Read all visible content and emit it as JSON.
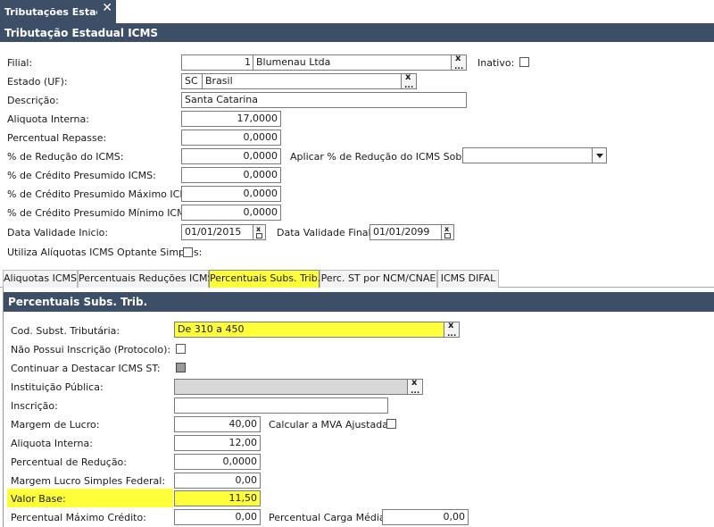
{
  "window": {
    "tab_title": "Tributações Estaduais",
    "close_glyph": "✕",
    "header_title": "Tributação Estadual ICMS"
  },
  "form": {
    "filial": {
      "label": "Filial:",
      "code": "1",
      "name": "Blumenau Ltda"
    },
    "inativo": {
      "label": "Inativo:",
      "checked": false
    },
    "estado": {
      "label": "Estado (UF):",
      "uf": "SC",
      "pais": "Brasil"
    },
    "descricao": {
      "label": "Descrição:",
      "value": "Santa Catarina"
    },
    "aliquota_interna": {
      "label": "Aliquota Interna:",
      "value": "17,0000"
    },
    "percentual_repasse": {
      "label": "Percentual Repasse:",
      "value": "0,0000"
    },
    "reducao_icms": {
      "label": "% de Redução do ICMS:",
      "value": "0,0000"
    },
    "aplicar_reducao": {
      "label": "Aplicar % de Redução do ICMS Sobre:",
      "value": ""
    },
    "credito_presumido": {
      "label": "% de Crédito Presumido ICMS:",
      "value": "0,0000"
    },
    "credito_presumido_max": {
      "label": "% de Crédito Presumido Máximo ICMS:",
      "value": "0,0000"
    },
    "credito_presumido_min": {
      "label": "% de Crédito Presumido Mínimo ICMS:",
      "value": "0,0000"
    },
    "data_inicio": {
      "label": "Data Validade Inicio:",
      "value": "01/01/2015"
    },
    "data_final": {
      "label": "Data Validade Final:",
      "value": "01/01/2099"
    },
    "optante_simples": {
      "label": "Utiliza Alíquotas ICMS Optante Simples:",
      "checked": false
    }
  },
  "tabs": [
    {
      "label": "Aliquotas ICMS",
      "active": false
    },
    {
      "label": "Percentuais Reduções ICMS",
      "active": false
    },
    {
      "label": "Percentuais Subs. Trib.",
      "active": true
    },
    {
      "label": "Perc. ST por NCM/CNAE",
      "active": false
    },
    {
      "label": "ICMS DIFAL",
      "active": false
    }
  ],
  "subst": {
    "panel_title": "Percentuais Subs. Trib.",
    "cod_subst": {
      "label": "Cod. Subst. Tributária:",
      "value": "De 310 a 450"
    },
    "nao_possui_inscricao": {
      "label": "Não Possui Inscrição (Protocolo):",
      "checked": false
    },
    "continuar_destacar": {
      "label": "Continuar a Destacar ICMS ST:",
      "checked": false
    },
    "instituicao_publica": {
      "label": "Instituição Pública:",
      "value": ""
    },
    "inscricao": {
      "label": "Inscrição:",
      "value": ""
    },
    "margem_lucro": {
      "label": "Margem de Lucro:",
      "value": "40,00"
    },
    "calcular_mva": {
      "label": "Calcular a MVA Ajustada:",
      "checked": false
    },
    "aliquota_interna": {
      "label": "Aliquota Interna:",
      "value": "12,00"
    },
    "percentual_reducao": {
      "label": "Percentual de Redução:",
      "value": "0,0000"
    },
    "margem_simples": {
      "label": "Margem Lucro Simples Federal:",
      "value": "0,00"
    },
    "valor_base": {
      "label": "Valor Base:",
      "value": "11,50"
    },
    "percentual_max_credito": {
      "label": "Percentual Máximo Crédito:",
      "value": "0,00"
    },
    "percentual_carga_media": {
      "label": "Percentual Carga Média:",
      "value": "0,00"
    }
  },
  "colors": {
    "header": "#3d4f66",
    "highlight": "#ffff3a"
  },
  "icons": {
    "clear": "clear-icon",
    "lookup": "lookup-ellipsis-icon",
    "calendar": "calendar-icon",
    "dropdown": "chevron-down-icon",
    "close": "close-icon"
  }
}
